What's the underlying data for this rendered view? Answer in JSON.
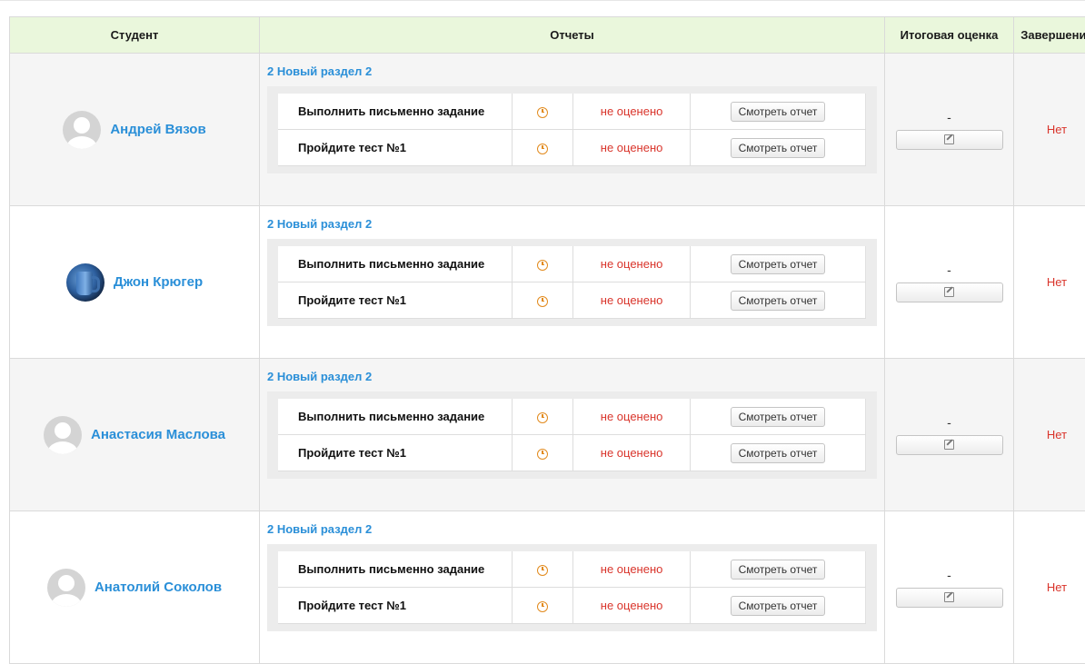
{
  "headers": {
    "student": "Студент",
    "reports": "Отчеты",
    "final_grade": "Итоговая оценка",
    "completion": "Завершение"
  },
  "rows": [
    {
      "student": {
        "name": "Андрей Вязов",
        "avatar": "default-user-icon"
      },
      "section": "2 Новый раздел 2",
      "activities": [
        {
          "name": "Выполнить письменно задание",
          "icon": "clock-icon",
          "status": "не оценено",
          "button": "Смотреть отчет"
        },
        {
          "name": "Пройдите тест №1",
          "icon": "clock-icon",
          "status": "не оценено",
          "button": "Смотреть отчет"
        }
      ],
      "final_grade": "-",
      "completion": "Нет"
    },
    {
      "student": {
        "name": "Джон Крюгер",
        "avatar": "photo-mug"
      },
      "section": "2 Новый раздел 2",
      "activities": [
        {
          "name": "Выполнить письменно задание",
          "icon": "clock-icon",
          "status": "не оценено",
          "button": "Смотреть отчет"
        },
        {
          "name": "Пройдите тест №1",
          "icon": "clock-icon",
          "status": "не оценено",
          "button": "Смотреть отчет"
        }
      ],
      "final_grade": "-",
      "completion": "Нет"
    },
    {
      "student": {
        "name": "Анастасия Маслова",
        "avatar": "default-user-icon"
      },
      "section": "2 Новый раздел 2",
      "activities": [
        {
          "name": "Выполнить письменно задание",
          "icon": "clock-icon",
          "status": "не оценено",
          "button": "Смотреть отчет"
        },
        {
          "name": "Пройдите тест №1",
          "icon": "clock-icon",
          "status": "не оценено",
          "button": "Смотреть отчет"
        }
      ],
      "final_grade": "-",
      "completion": "Нет"
    },
    {
      "student": {
        "name": "Анатолий Соколов",
        "avatar": "default-user-icon"
      },
      "section": "2 Новый раздел 2",
      "activities": [
        {
          "name": "Выполнить письменно задание",
          "icon": "clock-icon",
          "status": "не оценено",
          "button": "Смотреть отчет"
        },
        {
          "name": "Пройдите тест №1",
          "icon": "clock-icon",
          "status": "не оценено",
          "button": "Смотреть отчет"
        }
      ],
      "final_grade": "-",
      "completion": "Нет"
    }
  ],
  "colors": {
    "header_bg": "#eaf7dc",
    "link": "#2a8fd8",
    "status_red": "#d9342b",
    "pending_orange": "#e28b1e",
    "row_alt": "#f5f5f5"
  }
}
